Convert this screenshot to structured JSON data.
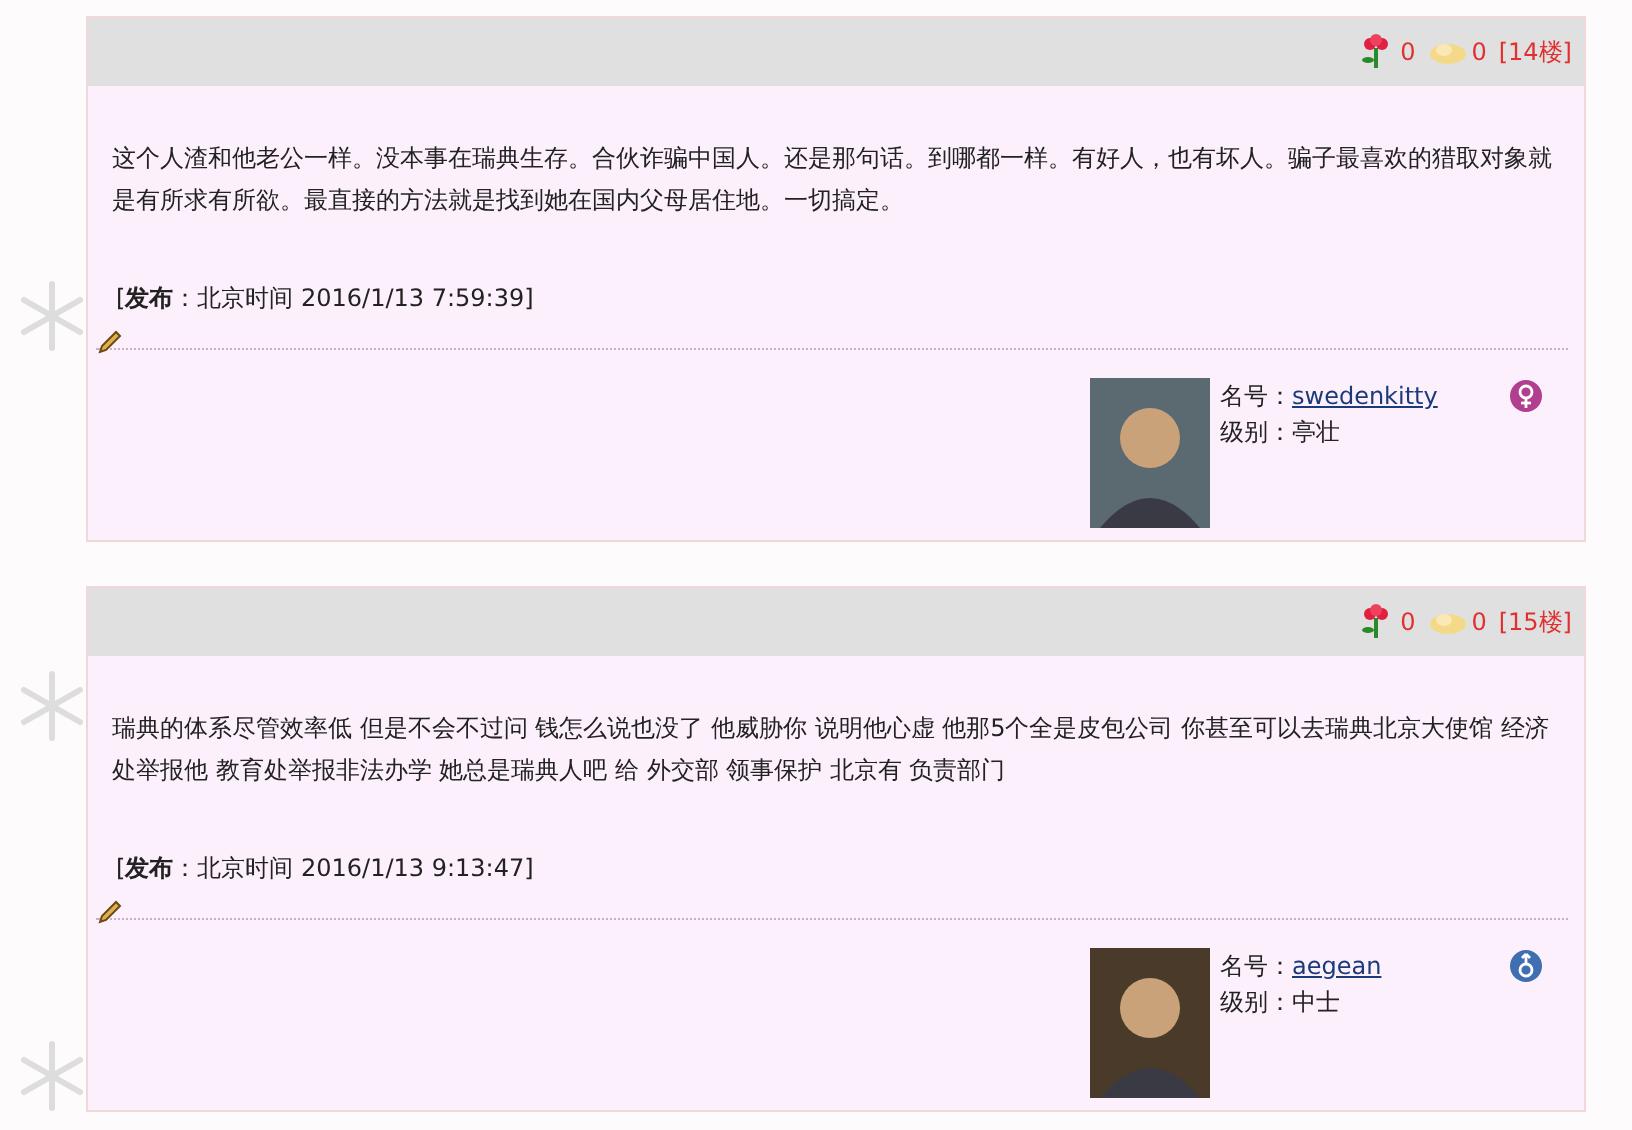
{
  "posts": [
    {
      "flowers": "0",
      "eggs": "0",
      "floor": "[14楼]",
      "body": "这个人渣和他老公一样。没本事在瑞典生存。合伙诈骗中国人。还是那句话。到哪都一样。有好人，也有坏人。骗子最喜欢的猎取对象就是有所求有所欲。最直接的方法就是找到她在国内父母居住地。一切搞定。",
      "publish": "[**发布**：北京时间 2016/1/13 7:59:39]",
      "name_label": "名号：",
      "username": "swedenkitty",
      "level_label": "级别：亭壮",
      "kind": "female"
    },
    {
      "flowers": "0",
      "eggs": "0",
      "floor": "[15楼]",
      "body": "瑞典的体系尽管效率低 但是不会不过问 钱怎么说也没了 他威胁你 说明他心虚 他那5个全是皮包公司 你甚至可以去瑞典北京大使馆 经济处举报他 教育处举报非法办学 她总是瑞典人吧 给 外交部 领事保护 北京有 负责部门",
      "publish": "[**发布**：北京时间 2016/1/13 9:13:47]",
      "name_label": "名号：",
      "username": "aegean",
      "level_label": "级别：中士",
      "kind": "male"
    }
  ]
}
